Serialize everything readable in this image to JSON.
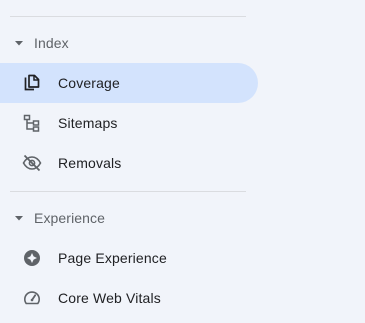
{
  "colors": {
    "background": "#f1f4fa",
    "active_background": "#d3e3fd",
    "divider": "#dadce0",
    "section_text": "#5f6368",
    "item_text": "#202124",
    "icon": "#5f6368"
  },
  "sections": [
    {
      "title": "Index",
      "expanded": true,
      "items": [
        {
          "label": "Coverage",
          "icon": "file-copy-icon",
          "active": true
        },
        {
          "label": "Sitemaps",
          "icon": "sitemap-icon",
          "active": false
        },
        {
          "label": "Removals",
          "icon": "eye-off-icon",
          "active": false
        }
      ]
    },
    {
      "title": "Experience",
      "expanded": true,
      "items": [
        {
          "label": "Page Experience",
          "icon": "page-experience-icon",
          "active": false
        },
        {
          "label": "Core Web Vitals",
          "icon": "speedometer-icon",
          "active": false
        }
      ]
    }
  ]
}
